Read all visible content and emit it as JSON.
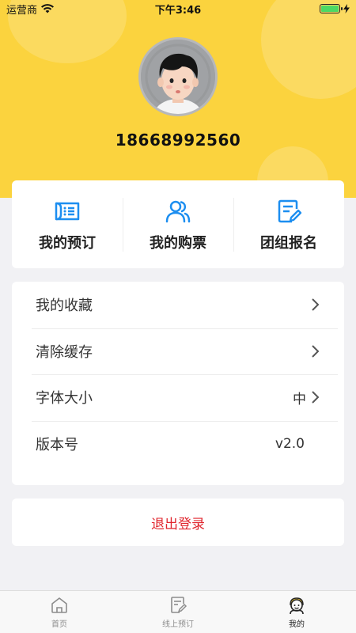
{
  "status_bar": {
    "carrier": "运营商",
    "time": "下午3:46",
    "battery_color": "#4cd964"
  },
  "profile": {
    "phone": "18668992560",
    "avatar_icon": "cartoon-boy-avatar"
  },
  "colors": {
    "header_yellow": "#fbd33e",
    "accent_blue": "#1c8ef0",
    "logout_red": "#e0262e"
  },
  "quick_actions": [
    {
      "label": "我的预订",
      "icon": "booking-list-icon"
    },
    {
      "label": "我的购票",
      "icon": "users-icon"
    },
    {
      "label": "团组报名",
      "icon": "edit-document-icon"
    }
  ],
  "settings": [
    {
      "label": "我的收藏",
      "value": "",
      "chevron": true
    },
    {
      "label": "清除缓存",
      "value": "",
      "chevron": true
    },
    {
      "label": "字体大小",
      "value": "中",
      "chevron": true
    },
    {
      "label": "版本号",
      "value": "v2.0",
      "chevron": false
    }
  ],
  "logout_label": "退出登录",
  "tabbar": [
    {
      "label": "首页",
      "icon": "home-icon",
      "active": false
    },
    {
      "label": "线上预订",
      "icon": "edit-document-icon",
      "active": false
    },
    {
      "label": "我的",
      "icon": "profile-face-icon",
      "active": true
    }
  ]
}
